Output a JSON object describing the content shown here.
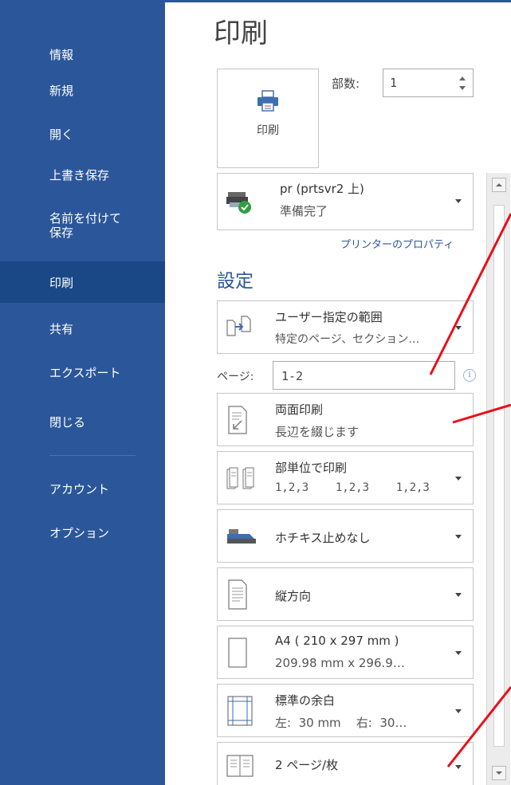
{
  "sidebar": {
    "items": [
      {
        "label": "情報"
      },
      {
        "label": "新規"
      },
      {
        "label": "開く"
      },
      {
        "label": "上書き保存"
      },
      {
        "label": "名前を付けて\n保存",
        "line1": "名前を付けて",
        "line2": "保存"
      },
      {
        "label": "印刷",
        "active": true
      },
      {
        "label": "共有"
      },
      {
        "label": "エクスポート"
      },
      {
        "label": "閉じる"
      },
      {
        "label": "アカウント"
      },
      {
        "label": "オプション"
      }
    ],
    "background": "#2b579a",
    "active_background": "#1a4785"
  },
  "main": {
    "title": "印刷",
    "print_button_label": "印刷",
    "copies_label": "部数:",
    "copies_value": "1",
    "printer": {
      "name": "pr (prtsvr2 上)",
      "status": "準備完了",
      "properties_link": "プリンターのプロパティ"
    },
    "settings_title": "設定",
    "pages_label": "ページ:",
    "pages_value": "1-2",
    "info_icon_text": "i",
    "settings": [
      {
        "title": "ユーザー指定の範囲",
        "sub": "特定のページ、セクション…",
        "icon": "custom-range-icon"
      },
      {
        "title": "両面印刷",
        "sub": "長辺を綴じます",
        "icon": "duplex-icon"
      },
      {
        "title": "部単位で印刷",
        "sub": "1,2,3    1,2,3    1,2,3",
        "icon": "collate-icon"
      },
      {
        "title": "ホチキス止めなし",
        "icon": "stapler-icon"
      },
      {
        "title": "縦方向",
        "icon": "portrait-icon"
      },
      {
        "title": "A4 ( 210 x 297 mm )",
        "sub": "209.98 mm x 296.9…",
        "icon": "paper-size-icon"
      },
      {
        "title": "標準の余白",
        "sub": "左:  30 mm    右:  30…",
        "icon": "margins-icon"
      },
      {
        "title": "2 ページ/枚",
        "icon": "pages-per-sheet-icon"
      }
    ]
  },
  "colors": {
    "accent": "#2b579a",
    "annotation": "#e8101a",
    "border": "#c6c6c6"
  }
}
